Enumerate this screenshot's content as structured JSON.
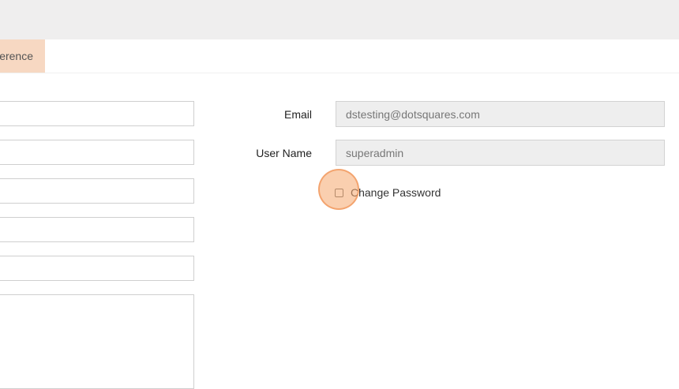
{
  "tabs": {
    "active_label": "Preference"
  },
  "form": {
    "email": {
      "label": "Email",
      "value": "dstesting@dotsquares.com"
    },
    "username": {
      "label": "User Name",
      "value": "superadmin"
    },
    "change_password": {
      "label": "Change Password",
      "checked": false
    }
  },
  "colors": {
    "topbar": "#efeeee",
    "active_tab": "#f7d8c2",
    "readonly_input": "#eeeeee",
    "click_highlight": "#f6a86e"
  }
}
